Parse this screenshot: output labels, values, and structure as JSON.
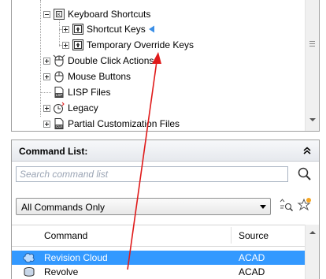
{
  "tree": {
    "items": [
      {
        "label": "Keyboard Shortcuts",
        "icon": "keyboard-shortcuts-icon",
        "expander": "minus"
      },
      {
        "label": "Shortcut Keys",
        "icon": "shortcut-keys-icon",
        "expander": "plus"
      },
      {
        "label": "Temporary Override Keys",
        "icon": "override-keys-icon",
        "expander": "plus"
      },
      {
        "label": "Double Click Actions",
        "icon": "double-click-icon",
        "expander": "plus"
      },
      {
        "label": "Mouse Buttons",
        "icon": "mouse-buttons-icon",
        "expander": "plus"
      },
      {
        "label": "LISP Files",
        "icon": "lisp-file-icon",
        "expander": "none"
      },
      {
        "label": "Legacy",
        "icon": "legacy-icon",
        "expander": "plus"
      },
      {
        "label": "Partial Customization Files",
        "icon": "partial-cui-icon",
        "expander": "plus"
      }
    ]
  },
  "command_list": {
    "title": "Command List:",
    "search_placeholder": "Search command list",
    "filter_value": "All Commands Only",
    "columns": {
      "command": "Command",
      "source": "Source"
    },
    "rows": [
      {
        "command": "Revision Cloud",
        "source": "ACAD",
        "icon": "revision-cloud-icon",
        "selected": true
      },
      {
        "command": "Revolve",
        "source": "ACAD",
        "icon": "revolve-icon",
        "selected": false
      }
    ]
  },
  "colors": {
    "selection": "#3399ff",
    "annotation_arrow": "#e01a1a",
    "marker_arrow": "#3a8ee6"
  }
}
